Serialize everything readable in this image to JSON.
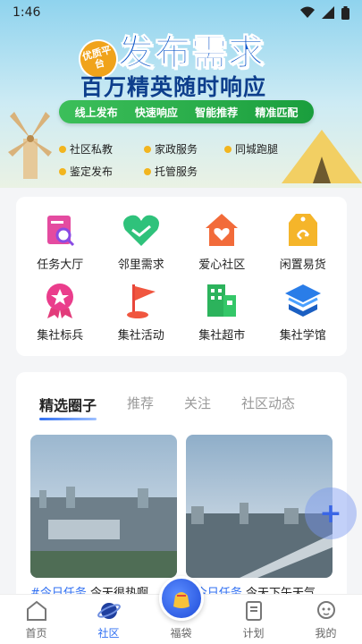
{
  "status_bar": {
    "time": "1:46"
  },
  "banner": {
    "badge": "优质平台",
    "headline": "发布需求",
    "subline": "百万精英随时响应",
    "features": [
      "线上发布",
      "快速响应",
      "智能推荐",
      "精准匹配"
    ],
    "tags": [
      "社区私教",
      "家政服务",
      "同城跑腿",
      "鉴定发布",
      "托管服务"
    ]
  },
  "grid": {
    "items": [
      {
        "label": "任务大厅",
        "icon": "task-board-icon"
      },
      {
        "label": "邻里需求",
        "icon": "handshake-heart-icon"
      },
      {
        "label": "爱心社区",
        "icon": "house-heart-icon"
      },
      {
        "label": "闲置易货",
        "icon": "recycle-tag-icon"
      },
      {
        "label": "集社标兵",
        "icon": "medal-star-icon"
      },
      {
        "label": "集社活动",
        "icon": "flag-icon"
      },
      {
        "label": "集社超市",
        "icon": "supermarket-icon"
      },
      {
        "label": "集社学馆",
        "icon": "academy-cap-icon"
      }
    ]
  },
  "circle": {
    "tabs": [
      "精选圈子",
      "推荐",
      "关注",
      "社区动态"
    ],
    "active_tab": 0,
    "posts": [
      {
        "hashtag": "#今日任务",
        "text": " 今天很热啊"
      },
      {
        "hashtag": "#今日任务",
        "text": " 今天下午天气"
      }
    ]
  },
  "fab": {
    "label": "+"
  },
  "bottom_nav": {
    "items": [
      {
        "label": "首页",
        "icon": "home-icon"
      },
      {
        "label": "社区",
        "icon": "planet-icon"
      },
      {
        "label": "福袋",
        "icon": "lucky-bag-icon"
      },
      {
        "label": "计划",
        "icon": "plan-icon"
      },
      {
        "label": "我的",
        "icon": "profile-icon"
      }
    ],
    "active": 1
  },
  "colors": {
    "accent": "#2f6ff2",
    "headline": "#0a55c9",
    "pill": "#1a9e3d"
  }
}
